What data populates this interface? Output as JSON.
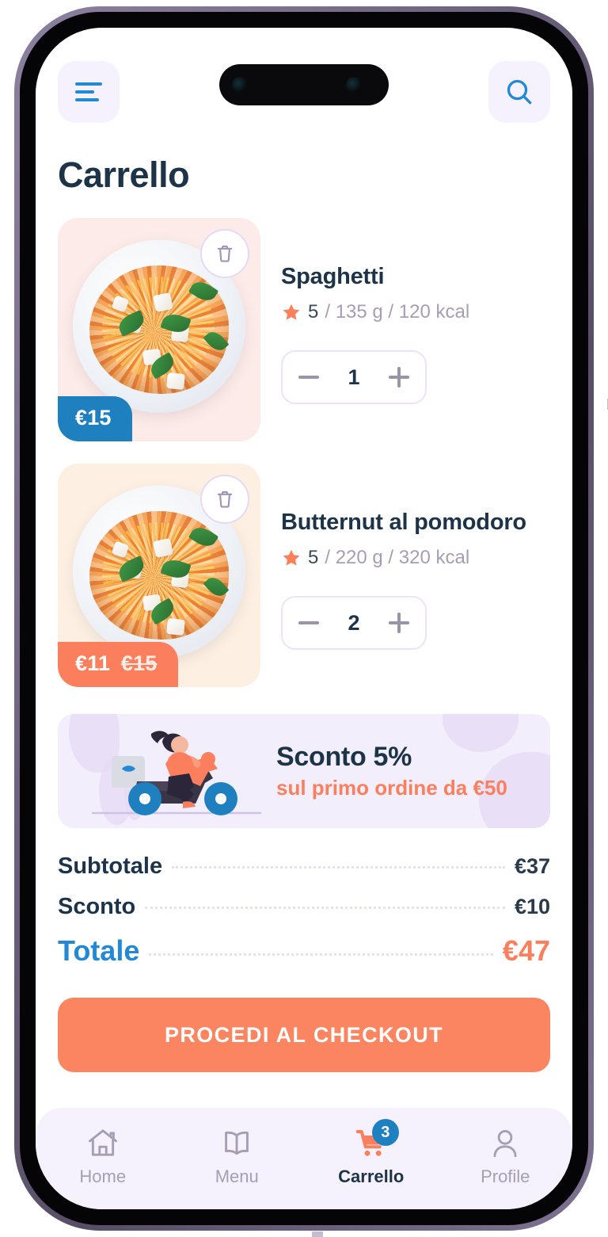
{
  "header": {
    "menu_icon": "hamburger-icon",
    "search_icon": "search-icon",
    "title": "Carrello"
  },
  "products": [
    {
      "name": "Spaghetti",
      "rating": "5",
      "meta": "/ 135 g / 120 kcal",
      "price": "€15",
      "price_old": "",
      "quantity": "1",
      "delete_icon": "trash-icon",
      "star_icon": "star-icon",
      "minus_label": "−",
      "plus_label": "+"
    },
    {
      "name": "Butternut al pomodoro",
      "rating": "5",
      "meta": "/ 220 g / 320 kcal",
      "price": "€11",
      "price_old": "€15",
      "quantity": "2",
      "delete_icon": "trash-icon",
      "star_icon": "star-icon",
      "minus_label": "−",
      "plus_label": "+"
    }
  ],
  "promo": {
    "title": "Sconto 5%",
    "subtitle": "sul primo ordine da €50",
    "illustration": "scooter-delivery-illustration"
  },
  "totals": {
    "subtotal_label": "Subtotale",
    "subtotal_value": "€37",
    "discount_label": "Sconto",
    "discount_value": "€10",
    "total_label": "Totale",
    "total_value": "€47"
  },
  "checkout": {
    "label": "PROCEDI AL CHECKOUT"
  },
  "bottom_nav": [
    {
      "label": "Home",
      "icon": "home-icon",
      "active": false,
      "badge": ""
    },
    {
      "label": "Menu",
      "icon": "book-icon",
      "active": false,
      "badge": ""
    },
    {
      "label": "Carrello",
      "icon": "cart-icon",
      "active": true,
      "badge": "3"
    },
    {
      "label": "Profile",
      "icon": "person-icon",
      "active": false,
      "badge": ""
    }
  ],
  "colors": {
    "accent_orange": "#fb7f5d",
    "accent_blue": "#2389d6",
    "price_blue": "#1f80c0",
    "navy": "#1d3348",
    "lavender": "#f6f2fd",
    "muted": "#a79db4"
  }
}
